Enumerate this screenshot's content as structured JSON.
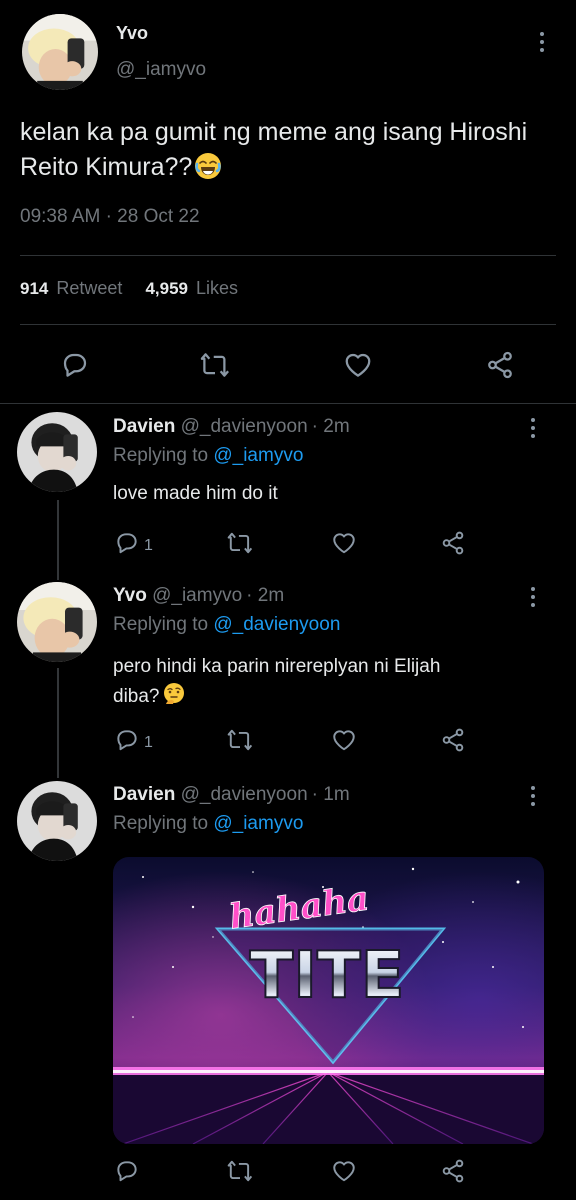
{
  "main_tweet": {
    "display_name": "Yvo",
    "handle": "@_iamyvo",
    "text": "kelan ka pa gumit ng meme ang isang Hiroshi Reito Kimura??",
    "emoji": "joy-emoji",
    "time": "09:38 AM",
    "separator": "·",
    "date": "28 Oct 22",
    "retweet_count": "914",
    "retweet_label": "Retweet",
    "like_count": "4,959",
    "like_label": "Likes"
  },
  "replies": [
    {
      "display_name": "Davien",
      "handle": "@_davienyoon",
      "age": "· 2m",
      "replying_prefix": "Replying to",
      "replying_to": "@_iamyvo",
      "text": "love made him do it",
      "reply_count": "1"
    },
    {
      "display_name": "Yvo",
      "handle": "@_iamyvo",
      "age": "· 2m",
      "replying_prefix": "Replying to",
      "replying_to": "@_davienyoon",
      "text_line1": "pero hindi ka parin nirereplyan ni Elijah",
      "text_line2": "diba?",
      "emoji": "thinking-emoji",
      "reply_count": "1"
    },
    {
      "display_name": "Davien",
      "handle": "@_davienyoon",
      "age": "· 1m",
      "replying_prefix": "Replying to",
      "replying_to": "@_iamyvo",
      "media": {
        "top_text": "hahaha",
        "main_text": "TITE"
      }
    }
  ],
  "colors": {
    "background": "#000000",
    "text": "#e7e9ea",
    "secondary": "#71767b",
    "link": "#1d9bf0",
    "divider": "#2f3336"
  },
  "icons": [
    "reply-icon",
    "retweet-icon",
    "like-icon",
    "share-icon",
    "more-icon"
  ]
}
